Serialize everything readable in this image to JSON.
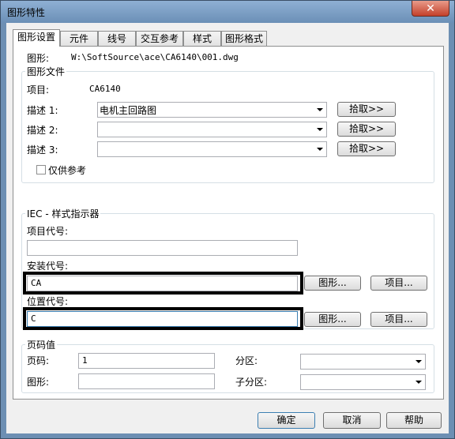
{
  "window": {
    "title": "图形特性",
    "close": "✕"
  },
  "tabs": [
    "图形设置",
    "元件",
    "线号",
    "交互参考",
    "样式",
    "图形格式"
  ],
  "drawing": {
    "label": "图形:",
    "path": "W:\\SoftSource\\ace\\CA6140\\001.dwg"
  },
  "drawing_file": {
    "legend": "图形文件",
    "project_label": "项目:",
    "project_value": "CA6140",
    "desc1_label": "描述 1:",
    "desc1_value": "电机主回路图",
    "desc2_label": "描述 2:",
    "desc3_label": "描述 3:",
    "pick_label": "拾取>>",
    "ref_only_label": "仅供参考"
  },
  "iec": {
    "legend": "IEC - 样式指示器",
    "project_code_label": "项目代号:",
    "install_code_label": "安装代号:",
    "install_code_value": "CA",
    "location_code_label": "位置代号:",
    "location_code_value": "C",
    "drawing_btn": "图形...",
    "project_btn": "项目..."
  },
  "page": {
    "legend": "页码值",
    "page_label": "页码:",
    "page_value": "1",
    "drawing_label": "图形:",
    "section_label": "分区:",
    "subsection_label": "子分区:"
  },
  "buttons": {
    "ok": "确定",
    "cancel": "取消",
    "help": "帮助"
  }
}
